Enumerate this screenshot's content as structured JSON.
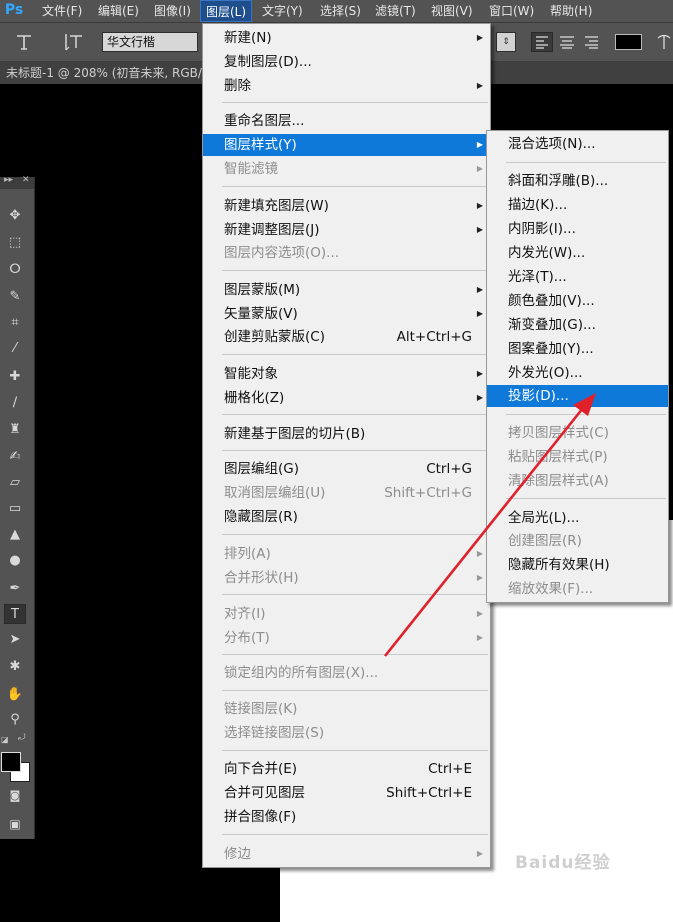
{
  "app": {
    "logo": "Ps"
  },
  "menubar": {
    "items": [
      "文件(F)",
      "编辑(E)",
      "图像(I)",
      "图层(L)",
      "文字(Y)",
      "选择(S)",
      "滤镜(T)",
      "视图(V)",
      "窗口(W)",
      "帮助(H)"
    ],
    "active": "图层(L)"
  },
  "options": {
    "font_family": "华文行楷"
  },
  "document": {
    "tab_title": "未标题-1 @ 208% (初音未来, RGB/8"
  },
  "layer_menu": {
    "items": [
      {
        "label": "新建(N)",
        "submenu": true
      },
      {
        "label": "复制图层(D)..."
      },
      {
        "label": "删除",
        "submenu": true
      },
      {
        "label": "重命名图层..."
      },
      {
        "label": "图层样式(Y)",
        "submenu": true,
        "highlighted": true
      },
      {
        "label": "智能滤镜",
        "submenu": true,
        "disabled": true
      },
      {
        "label": "新建填充图层(W)",
        "submenu": true
      },
      {
        "label": "新建调整图层(J)",
        "submenu": true
      },
      {
        "label": "图层内容选项(O)...",
        "disabled": true
      },
      {
        "label": "图层蒙版(M)",
        "submenu": true
      },
      {
        "label": "矢量蒙版(V)",
        "submenu": true
      },
      {
        "label": "创建剪贴蒙版(C)",
        "shortcut": "Alt+Ctrl+G"
      },
      {
        "label": "智能对象",
        "submenu": true
      },
      {
        "label": "栅格化(Z)",
        "submenu": true
      },
      {
        "label": "新建基于图层的切片(B)"
      },
      {
        "label": "图层编组(G)",
        "shortcut": "Ctrl+G"
      },
      {
        "label": "取消图层编组(U)",
        "shortcut": "Shift+Ctrl+G",
        "disabled": true
      },
      {
        "label": "隐藏图层(R)"
      },
      {
        "label": "排列(A)",
        "submenu": true,
        "disabled": true
      },
      {
        "label": "合并形状(H)",
        "submenu": true,
        "disabled": true
      },
      {
        "label": "对齐(I)",
        "submenu": true,
        "disabled": true
      },
      {
        "label": "分布(T)",
        "submenu": true,
        "disabled": true
      },
      {
        "label": "锁定组内的所有图层(X)...",
        "disabled": true
      },
      {
        "label": "链接图层(K)",
        "disabled": true
      },
      {
        "label": "选择链接图层(S)",
        "disabled": true
      },
      {
        "label": "向下合并(E)",
        "shortcut": "Ctrl+E"
      },
      {
        "label": "合并可见图层",
        "shortcut": "Shift+Ctrl+E"
      },
      {
        "label": "拼合图像(F)"
      },
      {
        "label": "修边",
        "submenu": true,
        "disabled": true
      }
    ]
  },
  "layer_style_menu": {
    "items": [
      {
        "label": "混合选项(N)..."
      },
      {
        "label": "斜面和浮雕(B)..."
      },
      {
        "label": "描边(K)..."
      },
      {
        "label": "内阴影(I)..."
      },
      {
        "label": "内发光(W)..."
      },
      {
        "label": "光泽(T)..."
      },
      {
        "label": "颜色叠加(V)..."
      },
      {
        "label": "渐变叠加(G)..."
      },
      {
        "label": "图案叠加(Y)..."
      },
      {
        "label": "外发光(O)..."
      },
      {
        "label": "投影(D)...",
        "highlighted": true
      },
      {
        "label": "拷贝图层样式(C)",
        "disabled": true
      },
      {
        "label": "粘贴图层样式(P)",
        "disabled": true
      },
      {
        "label": "清除图层样式(A)",
        "disabled": true
      },
      {
        "label": "全局光(L)..."
      },
      {
        "label": "创建图层(R)",
        "disabled": true
      },
      {
        "label": "隐藏所有效果(H)"
      },
      {
        "label": "缩放效果(F)...",
        "disabled": true
      }
    ]
  },
  "colors": {
    "highlight": "#0f79d9",
    "annotation_arrow": "#e0202a",
    "menu_bg": "#f0f0f0",
    "chrome": "#535353"
  },
  "watermark": "Baidu经验"
}
